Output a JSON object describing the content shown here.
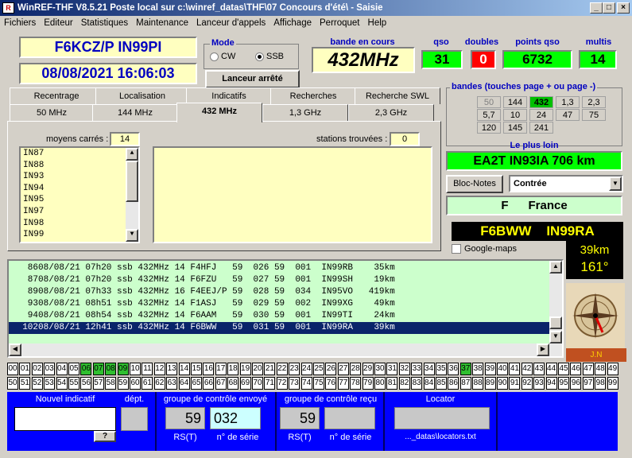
{
  "window": {
    "title": "WinREF-THF V8.5.21 Poste local sur c:\\winref_datas\\THF\\07 Concours d'été\\ -  Saisie",
    "icon": "R",
    "min": "_",
    "max": "□",
    "close": "×"
  },
  "menu": [
    "Fichiers",
    "Editeur",
    "Statistiques",
    "Maintenance",
    "Lanceur d'appels",
    "Affichage",
    "Perroquet",
    "Help"
  ],
  "station": {
    "callsign": "F6KCZ/P  IN99PI",
    "datetime": "08/08/2021   16:06:03"
  },
  "mode": {
    "title": "Mode",
    "options": [
      "CW",
      "SSB"
    ],
    "selected": "SSB"
  },
  "launcher_label": "Lanceur arrêté",
  "band": {
    "label": "bande en cours",
    "value": "432MHz"
  },
  "stats": {
    "qso_label": "qso",
    "qso": "31",
    "doubles_label": "doubles",
    "doubles": "0",
    "points_label": "points qso",
    "points": "6732",
    "multis_label": "multis",
    "multis": "14"
  },
  "tabs_top": [
    "Recentrage",
    "Localisation",
    "Indicatifs",
    "Recherches",
    "Recherche SWL"
  ],
  "tabs_bottom": [
    "50 MHz",
    "144 MHz",
    "432 MHz",
    "1,3 GHz",
    "2,3 GHz"
  ],
  "active_tab": "432 MHz",
  "squares": {
    "label": "moyens carrés :",
    "count": "14",
    "items": [
      "IN87",
      "IN88",
      "IN93",
      "IN94",
      "IN95",
      "IN97",
      "IN98",
      "IN99"
    ]
  },
  "found": {
    "label": "stations trouvées :",
    "count": "0"
  },
  "bands": {
    "title": "bandes (touches page + ou page -)",
    "rows": [
      [
        "50",
        "144",
        "432",
        "1,3",
        "2,3"
      ],
      [
        "5,7",
        "10",
        "24",
        "47",
        "75"
      ],
      [
        "120",
        "145",
        "241"
      ]
    ],
    "active": "432",
    "disabled": "50"
  },
  "farthest": {
    "label": "Le plus loin",
    "value": "EA2T  IN93IA  706 km"
  },
  "notes_button": "Bloc-Notes",
  "country_select": "Contrée",
  "country": {
    "value": "F      France"
  },
  "current": {
    "call": "F6BWW    IN99RA",
    "km": "39km",
    "deg": "161°"
  },
  "google_maps": "Google-maps",
  "compass_label": "J.N",
  "log": [
    [
      "86",
      "08/08/21",
      "07h20",
      "ssb",
      "432MHz",
      "14",
      "F4HFJ",
      "59",
      "026",
      "59",
      "001",
      "IN99RB",
      "35",
      "km"
    ],
    [
      "87",
      "08/08/21",
      "07h20",
      "ssb",
      "432MHz",
      "14",
      "F6FZU",
      "59",
      "027",
      "59",
      "001",
      "IN99SH",
      "19",
      "km"
    ],
    [
      "89",
      "08/08/21",
      "07h33",
      "ssb",
      "432MHz",
      "16",
      "F4EEJ/P",
      "59",
      "028",
      "59",
      "034",
      "IN95VO",
      "419",
      "km"
    ],
    [
      "93",
      "08/08/21",
      "08h51",
      "ssb",
      "432MHz",
      "14",
      "F1ASJ",
      "59",
      "029",
      "59",
      "002",
      "IN99XG",
      "49",
      "km"
    ],
    [
      "94",
      "08/08/21",
      "08h54",
      "ssb",
      "432MHz",
      "14",
      "F6AAM",
      "59",
      "030",
      "59",
      "001",
      "IN99TI",
      "24",
      "km"
    ],
    [
      "102",
      "08/08/21",
      "12h41",
      "ssb",
      "432MHz",
      "14",
      "F6BWW",
      "59",
      "031",
      "59",
      "001",
      "IN99RA",
      "39",
      "km"
    ]
  ],
  "selected_row": 5,
  "numbers_green": [
    "06",
    "07",
    "08",
    "09",
    "37"
  ],
  "entry": {
    "new_call_label": "Nouvel indicatif",
    "dept_label": "dépt.",
    "help": "?",
    "sent_label": "groupe de contrôle envoyé",
    "sent_rs": "59",
    "sent_serial": "032",
    "rs_label": "RS(T)",
    "serial_label": "n° de série",
    "recv_label": "groupe de contrôle reçu",
    "recv_rs": "59",
    "locator_label": "Locator",
    "locator_file": "..._datas\\locators.txt"
  }
}
